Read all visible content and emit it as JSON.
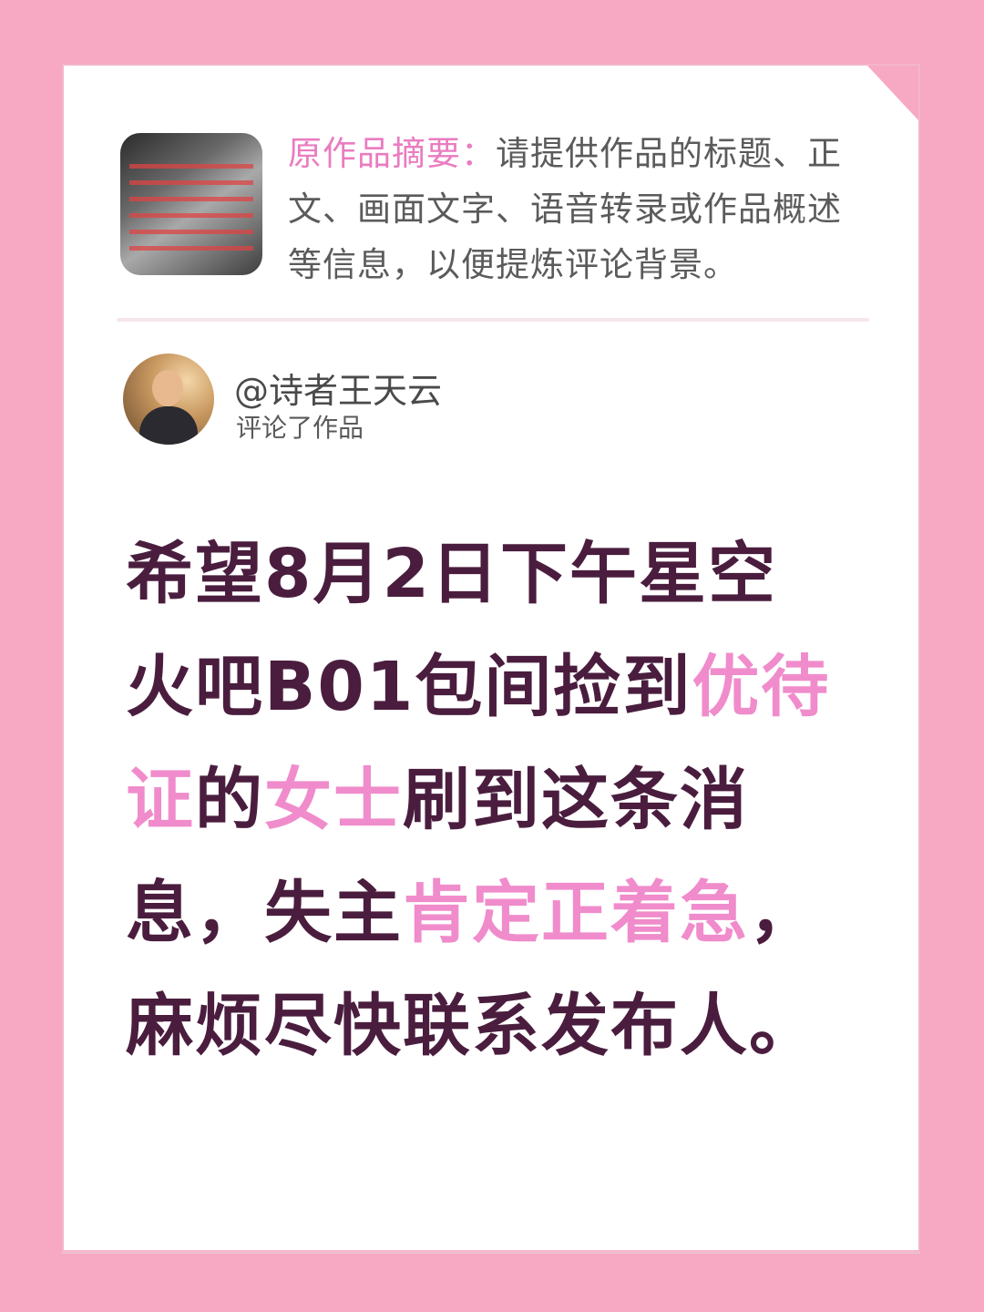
{
  "colors": {
    "background": "#f7a9c4",
    "card": "#ffffff",
    "label_pink": "#ea7cc0",
    "highlight_pink": "#f08ccb",
    "comment_text": "#4a1d3e",
    "summary_text": "#5b5b5b"
  },
  "summary": {
    "label": "原作品摘要：",
    "text": "请提供作品的标题、正文、画面文字、语音转录或作品概述等信息，以便提炼评论背景。"
  },
  "commenter": {
    "handle": "@诗者王天云",
    "action": "评论了作品"
  },
  "comment": {
    "segments": [
      "希望8月2日下午星空火吧B01包间捡到",
      "优待证",
      "的",
      "女士",
      "刷到这条消息，失主",
      "肯定正着急",
      "，麻烦尽快联系发布人。"
    ]
  }
}
